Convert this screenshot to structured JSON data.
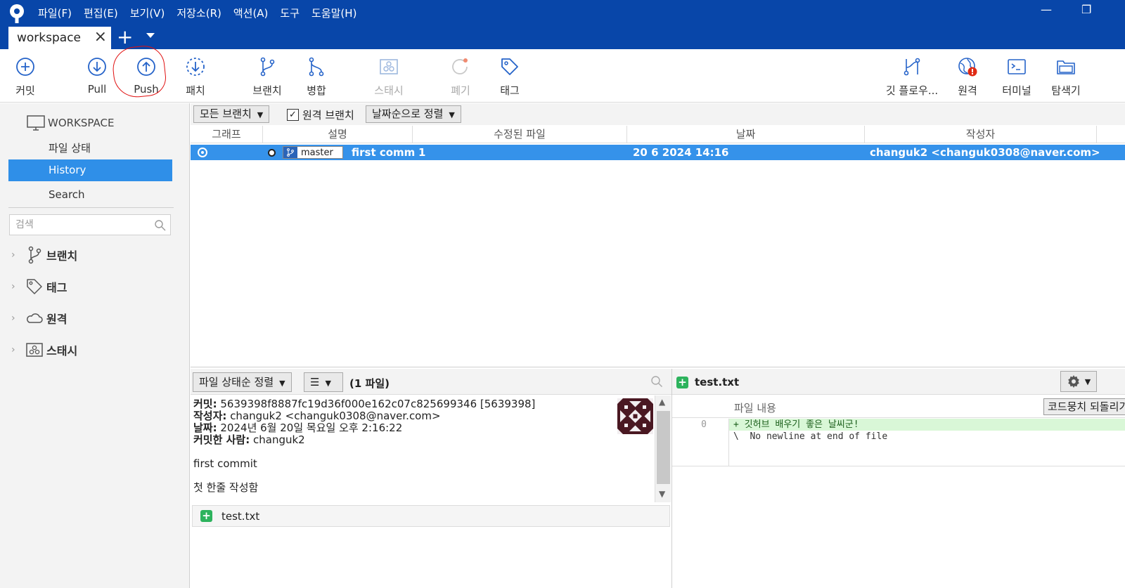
{
  "colors": {
    "titlebar": "#0846a9",
    "selection": "#3592ea",
    "sidebar_active": "#2f8fe8",
    "added": "#2db35d",
    "annotation": "#e01010"
  },
  "menu": [
    "파일(F)",
    "편집(E)",
    "보기(V)",
    "저장소(R)",
    "액션(A)",
    "도구",
    "도움말(H)"
  ],
  "tab": {
    "label": "workspace"
  },
  "toolbar": {
    "commit": "커밋",
    "pull": "Pull",
    "push": "Push",
    "fetch": "패치",
    "branch": "브랜치",
    "merge": "병합",
    "stash": "스태시",
    "discard": "폐기",
    "tag": "태그",
    "gitflow": "깃 플로우...",
    "remote": "원격",
    "terminal": "터미널",
    "explorer": "탐색기"
  },
  "sidebar": {
    "workspace": "WORKSPACE",
    "file_status": "파일 상태",
    "history": "History",
    "search": "Search",
    "search_placeholder": "검색",
    "branches": "브랜치",
    "tags": "태그",
    "remotes": "원격",
    "stashes": "스태시"
  },
  "filters": {
    "branches": "모든 브랜치",
    "remote_branches": "원격 브랜치",
    "sort": "날짜순으로 정렬"
  },
  "history": {
    "columns": [
      "그래프",
      "설명",
      "수정된 파일",
      "날짜",
      "작성자"
    ],
    "rows": [
      {
        "branch": "master",
        "description": "first comm",
        "files": "1",
        "date": "20 6 2024 14:16",
        "author": "changuk2 <changuk0308@naver.com>"
      }
    ]
  },
  "file_list": {
    "sort": "파일 상태순 정렬",
    "count": "(1 파일)",
    "files": [
      "test.txt"
    ]
  },
  "commit": {
    "commit_label": "커밋:",
    "commit_value": "5639398f8887fc19d36f000e162c07c825699346 [5639398]",
    "author_label": "작성자:",
    "author_value": "changuk2 <changuk0308@naver.com>",
    "date_label": "날짜:",
    "date_value": "2024년 6월 20일 목요일 오후 2:16:22",
    "committer_label": "커밋한 사람:",
    "committer_value": "changuk2",
    "message_line1": "first commit",
    "message_line2": "첫 한줄 작성함"
  },
  "diff": {
    "file": "test.txt",
    "header": "파일 내용",
    "code_button": "코드뭉치 되돌리기",
    "line_number": "0",
    "lines": [
      "+ 깃허브 배우기 좋은 날씨군!",
      "\\  No newline at end of file"
    ]
  }
}
